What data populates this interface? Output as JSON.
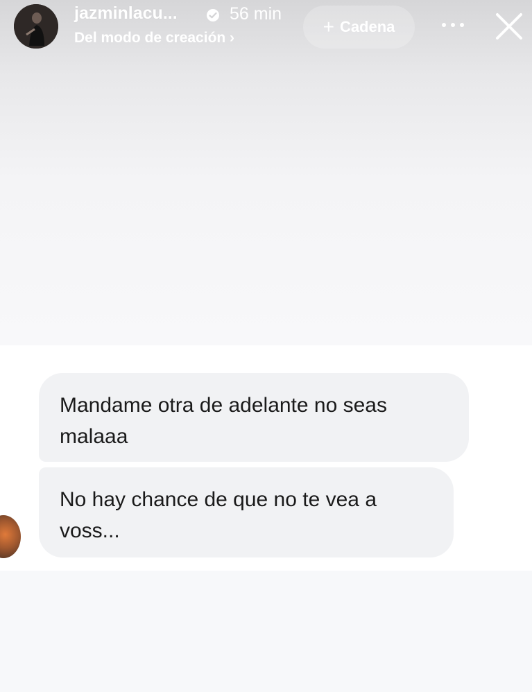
{
  "header": {
    "username": "jazminlacu...",
    "time": "56 min",
    "subtitle": "Del modo de creación ›",
    "chain_button": {
      "icon": "plus-icon",
      "label": "Cadena"
    },
    "more_icon": "more-icon",
    "close_icon": "close-icon"
  },
  "messages": [
    {
      "text": "Mandame otra de adelante no seas malaaa"
    },
    {
      "text": "No hay chance de que no te vea a voss..."
    }
  ],
  "colors": {
    "bubble_bg": "#f1f2f4",
    "text": "#1a1a1a",
    "header_text": "#ffffff"
  }
}
